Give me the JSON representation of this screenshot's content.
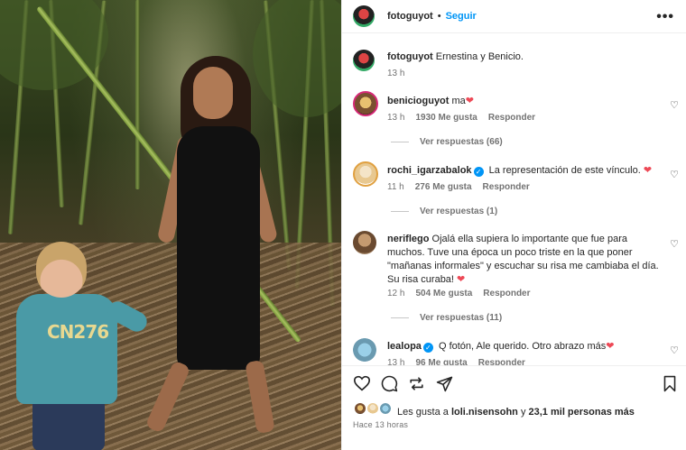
{
  "post": {
    "image_alt": "Ernestina y Benicio photo",
    "shirt_print": "CN276"
  },
  "header": {
    "username": "fotoguyot",
    "separator": "•",
    "follow_label": "Seguir",
    "more_icon": "more-horizontal-icon"
  },
  "caption": {
    "username": "fotoguyot",
    "text": "Ernestina y Benicio.",
    "time": "13 h"
  },
  "comments": [
    {
      "username": "benicioguyot",
      "verified": false,
      "text": "ma",
      "emoji": "❤",
      "time": "13 h",
      "likes": "1930 Me gusta",
      "reply_label": "Responder",
      "view_replies": "Ver respuestas (66)"
    },
    {
      "username": "rochi_igarzabalok",
      "verified": true,
      "text": "La representación de este vínculo.",
      "emoji": "❤",
      "time": "11 h",
      "likes": "276 Me gusta",
      "reply_label": "Responder",
      "view_replies": "Ver respuestas (1)"
    },
    {
      "username": "neriflego",
      "verified": false,
      "text": "Ojalá ella supiera lo importante que fue para muchos. Tuve una época un poco triste en la que poner \"mañanas informales\" y escuchar su risa me cambiaba el día. Su risa curaba!",
      "emoji": "❤",
      "time": "12 h",
      "likes": "504 Me gusta",
      "reply_label": "Responder",
      "view_replies": "Ver respuestas (11)"
    },
    {
      "username": "lealopa",
      "verified": true,
      "text": "Q fotón, Ale querido. Otro abrazo más",
      "emoji": "❤",
      "time": "13 h",
      "likes": "96 Me gusta",
      "reply_label": "Responder"
    }
  ],
  "footer": {
    "likes_prefix": "Les gusta a ",
    "likes_user": "loli.nisensohn",
    "likes_mid": " y ",
    "likes_count": "23,1 mil personas más",
    "time_ago": "Hace 13 horas"
  },
  "icons": {
    "like": "heart-outline-icon",
    "comment": "comment-bubble-icon",
    "share": "repost-icon",
    "send": "paper-plane-icon",
    "save": "bookmark-icon"
  },
  "colors": {
    "accent": "#0095f6",
    "heart": "#ed4956",
    "muted": "#737373",
    "text": "#262626"
  }
}
